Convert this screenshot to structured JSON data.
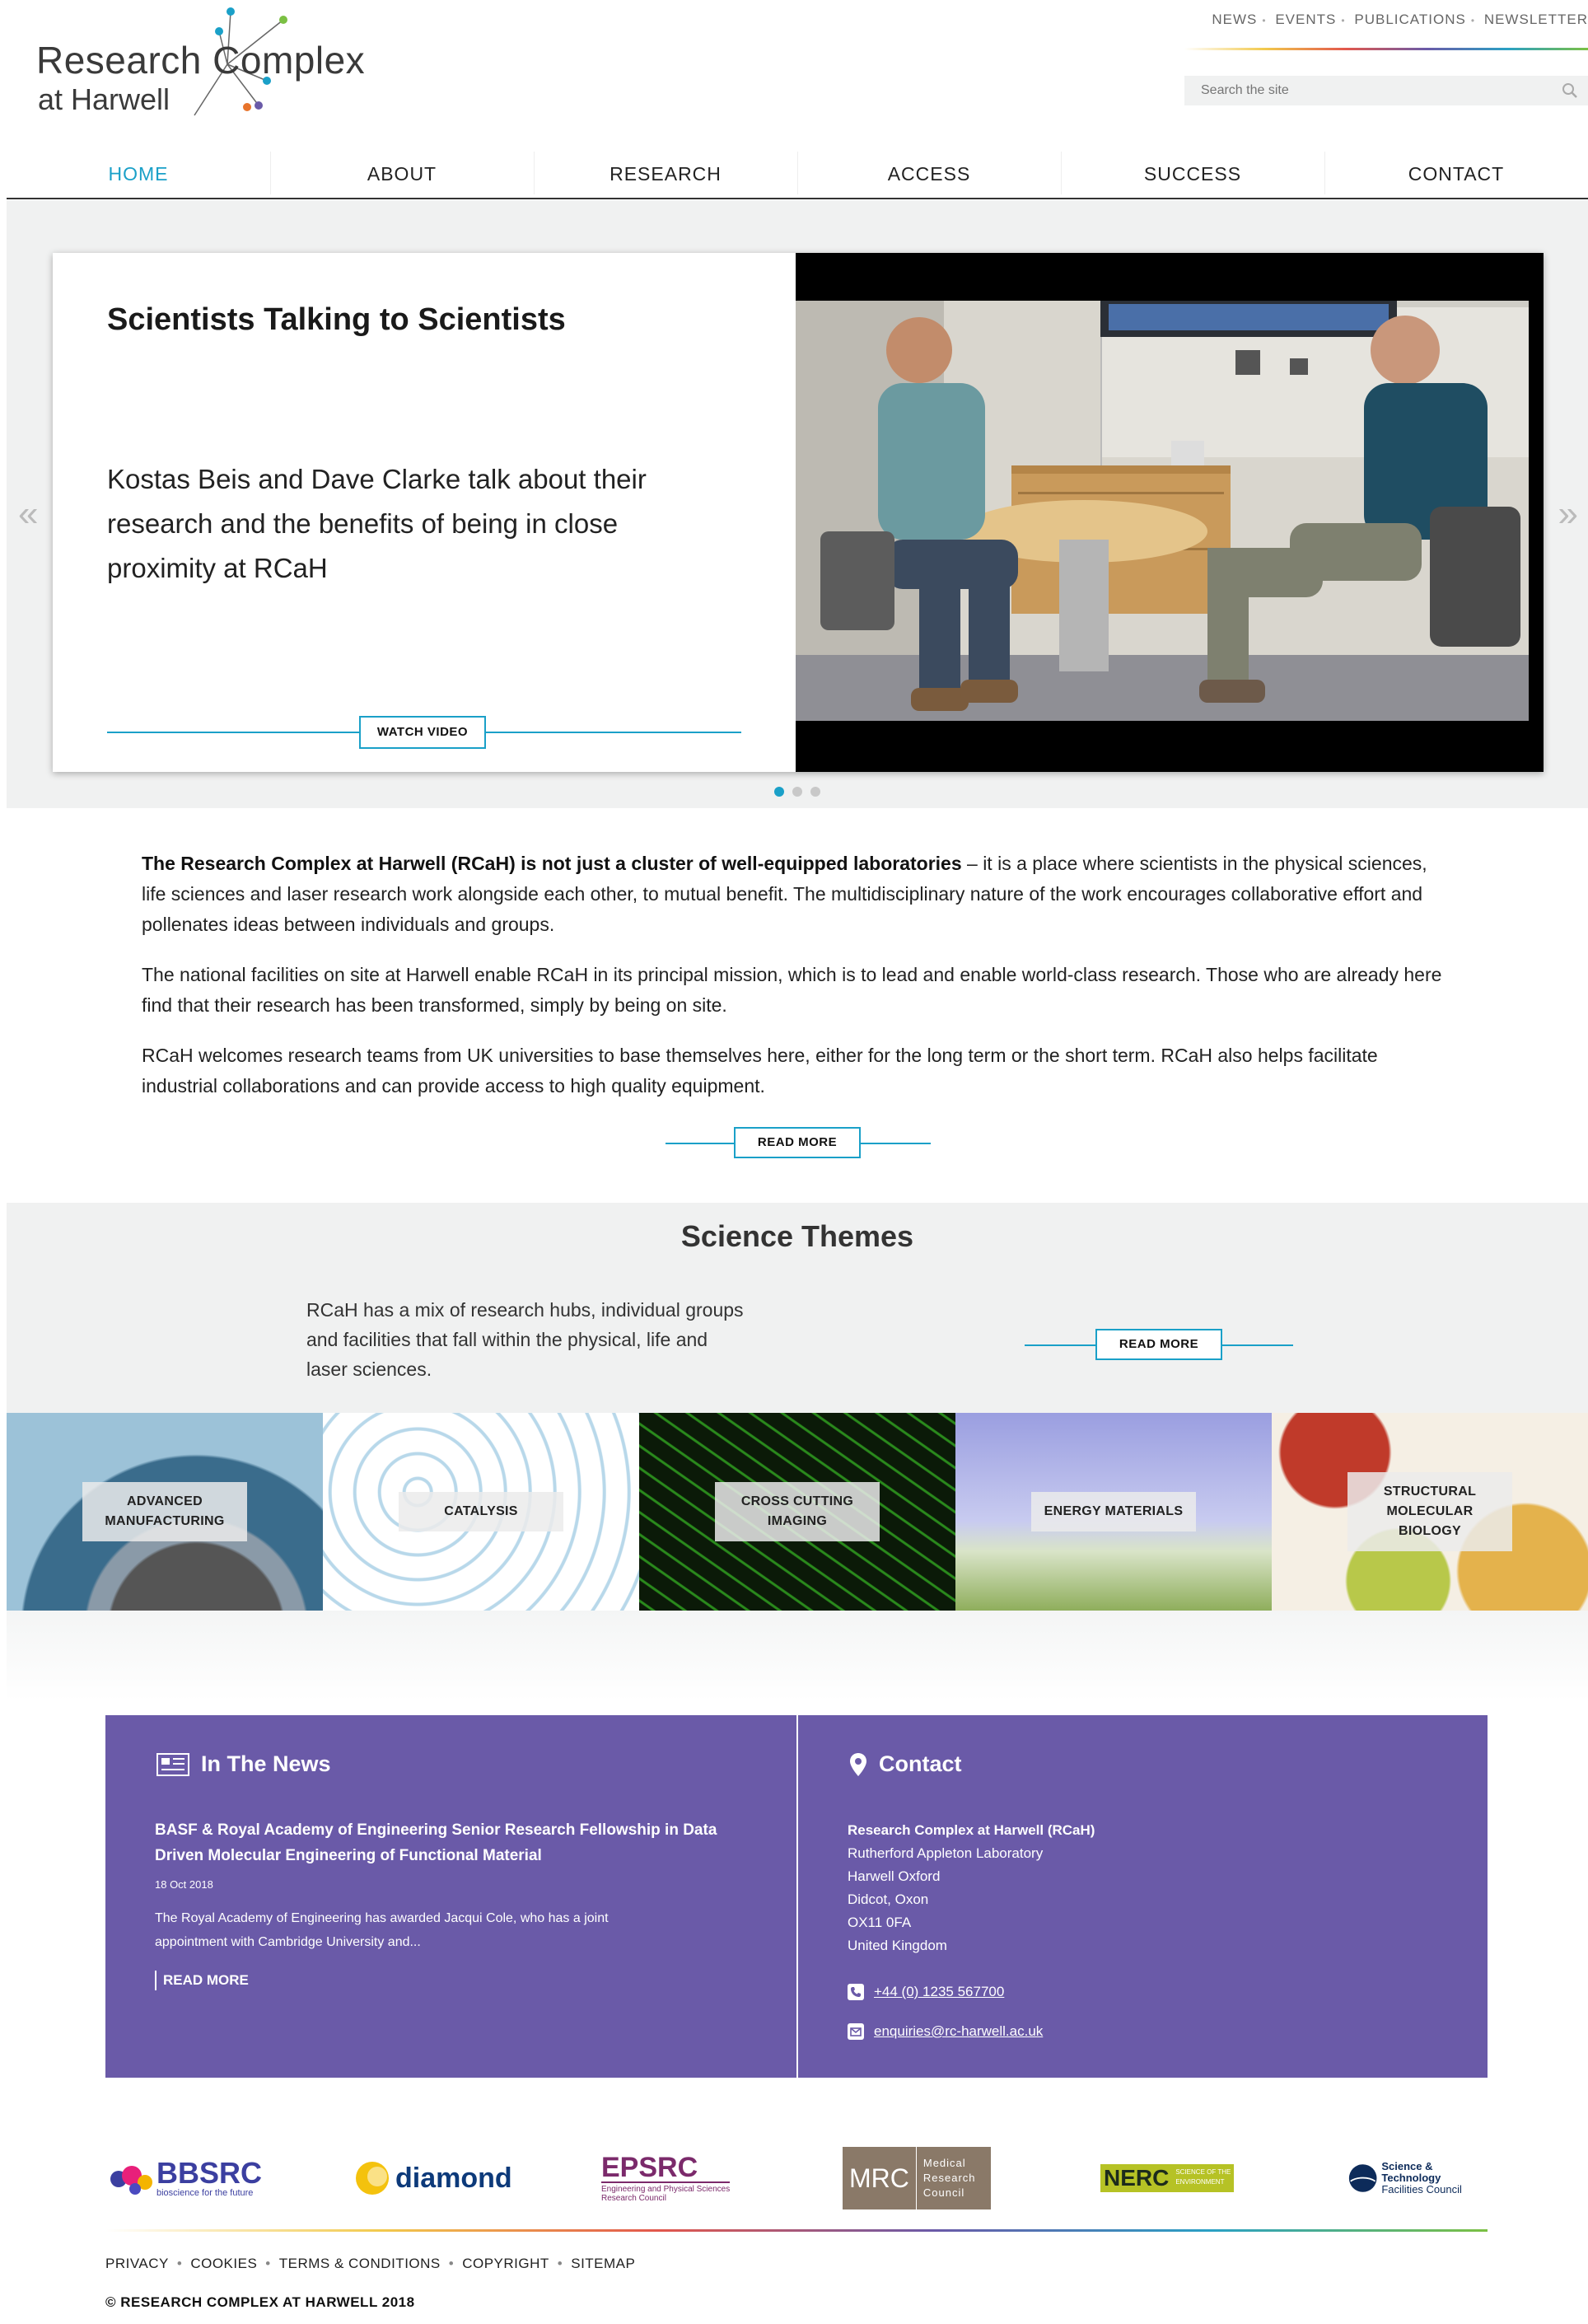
{
  "logo": {
    "line1": "Research Complex",
    "line2": "at Harwell"
  },
  "top_nav": [
    "NEWS",
    "EVENTS",
    "PUBLICATIONS",
    "NEWSLETTER"
  ],
  "search": {
    "placeholder": "Search the site"
  },
  "main_nav": [
    {
      "label": "HOME",
      "active": true
    },
    {
      "label": "ABOUT"
    },
    {
      "label": "RESEARCH"
    },
    {
      "label": "ACCESS"
    },
    {
      "label": "SUCCESS"
    },
    {
      "label": "CONTACT"
    }
  ],
  "hero": {
    "title": "Scientists Talking to Scientists",
    "description": "Kostas Beis and Dave Clarke talk about their research and the benefits of being in close proximity at RCaH",
    "button": "WATCH VIDEO",
    "slide_count": 3,
    "active_slide": 1
  },
  "intro": {
    "p1_bold": "The Research Complex at Harwell (RCaH) is not just a cluster of well-equipped laboratories",
    "p1_rest": " – it is a place where scientists in the physical sciences, life sciences and laser research work alongside each other, to mutual benefit. The multidisciplinary nature of the work encourages collaborative effort and pollenates ideas between individuals and groups.",
    "p2": "The national facilities on site at Harwell enable RCaH in its principal mission, which is to lead and enable world-class research. Those who are already here find that their research has been transformed, simply by being on site.",
    "p3": "RCaH welcomes research teams from UK universities to base themselves here, either for the long term or the short term. RCaH also helps facilitate industrial collaborations and can provide access to high quality equipment.",
    "button": "READ MORE"
  },
  "themes": {
    "title": "Science Themes",
    "description": "RCaH has a mix of research hubs, individual groups and facilities that fall within the physical, life and laser sciences.",
    "button": "READ MORE",
    "tiles": [
      {
        "line1": "ADVANCED",
        "line2": "MANUFACTURING",
        "line3": ""
      },
      {
        "line1": "CATALYSIS",
        "line2": "",
        "line3": ""
      },
      {
        "line1": "CROSS CUTTING",
        "line2": "IMAGING",
        "line3": ""
      },
      {
        "line1": "ENERGY MATERIALS",
        "line2": "",
        "line3": ""
      },
      {
        "line1": "STRUCTURAL",
        "line2": "MOLECULAR",
        "line3": "BIOLOGY"
      }
    ]
  },
  "news": {
    "heading": "In The News",
    "title": "BASF & Royal Academy of Engineering Senior Research Fellowship in Data Driven Molecular Engineering of Functional Material",
    "date": "18 Oct 2018",
    "excerpt": "The Royal Academy of Engineering has awarded Jacqui Cole, who has a joint appointment with Cambridge University and...",
    "more": "READ MORE"
  },
  "contact": {
    "heading": "Contact",
    "name": "Research Complex at Harwell (RCaH)",
    "address": [
      "Rutherford Appleton Laboratory",
      "Harwell Oxford",
      "Didcot, Oxon",
      "OX11 0FA",
      "United Kingdom"
    ],
    "phone": "+44 (0) 1235 567700",
    "email": "enquiries@rc-harwell.ac.uk"
  },
  "partners": {
    "bbsrc": "BBSRC",
    "bbsrc_sub": "bioscience for the future",
    "diamond": "diamond",
    "epsrc": "EPSRC",
    "epsrc_sub1": "Engineering and Physical Sciences",
    "epsrc_sub2": "Research Council",
    "mrc": "MRC",
    "mrc_sub1": "Medical",
    "mrc_sub2": "Research",
    "mrc_sub3": "Council",
    "nerc": "NERC",
    "nerc_sub1": "SCIENCE OF THE",
    "nerc_sub2": "ENVIRONMENT",
    "stfc1": "Science & Technology",
    "stfc2": "Facilities Council"
  },
  "footer_links": [
    "PRIVACY",
    "COOKIES",
    "TERMS & CONDITIONS",
    "COPYRIGHT",
    "SITEMAP"
  ],
  "copyright": "© RESEARCH COMPLEX AT HARWELL 2018",
  "colors": {
    "accent": "#1aa0c8",
    "panel": "#6a5aa8",
    "band": "#f0f1f1"
  }
}
